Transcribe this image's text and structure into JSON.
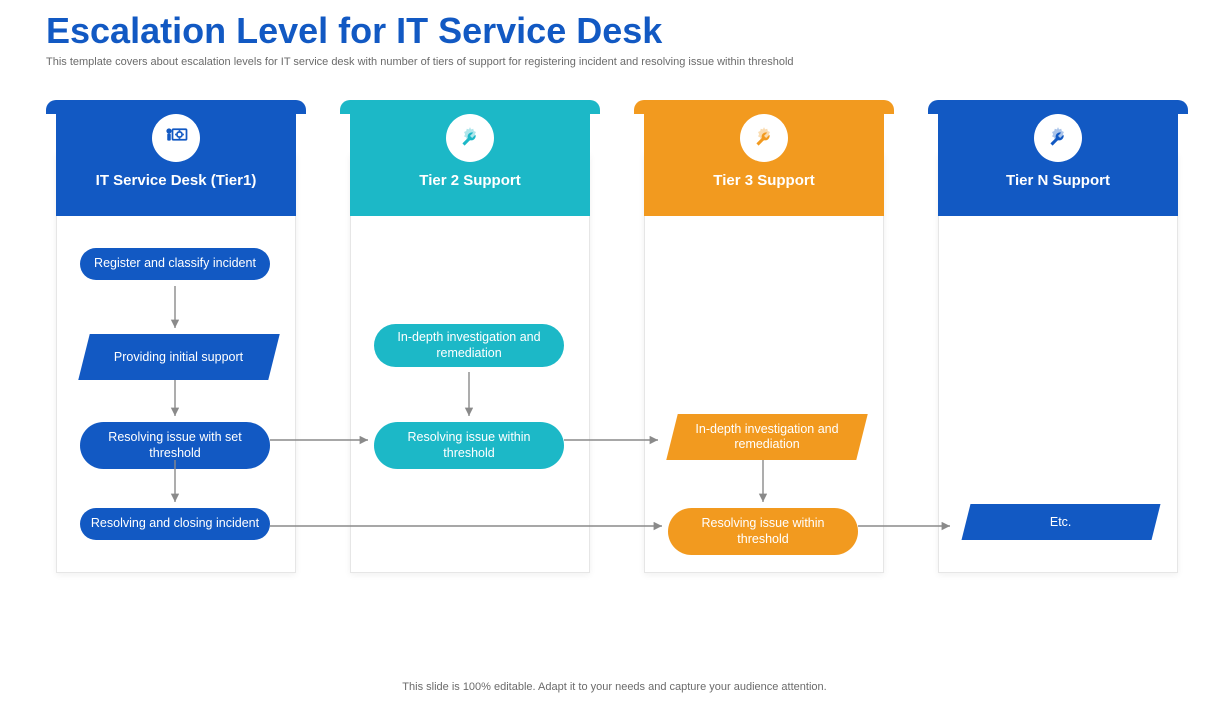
{
  "title": "Escalation Level for IT Service Desk",
  "subtitle": "This template covers about escalation levels for IT  service desk with number of tiers of support for registering incident and resolving issue within threshold",
  "footer": "This slide is 100% editable. Adapt it to your  needs and capture your audience attention.",
  "tiers": {
    "t1": "IT Service Desk (Tier1)",
    "t2": "Tier 2 Support",
    "t3": "Tier 3 Support",
    "t4": "Tier N Support"
  },
  "boxes": {
    "c1_register": "Register and classify incident",
    "c1_initial": "Providing initial support",
    "c1_threshold": "Resolving issue with set threshold",
    "c1_close": "Resolving and closing incident",
    "c2_invest": "In-depth investigation and remediation",
    "c2_resolve": "Resolving issue within threshold",
    "c3_invest": "In-depth investigation and remediation",
    "c3_resolve": "Resolving issue within threshold",
    "c4_etc": "Etc."
  }
}
